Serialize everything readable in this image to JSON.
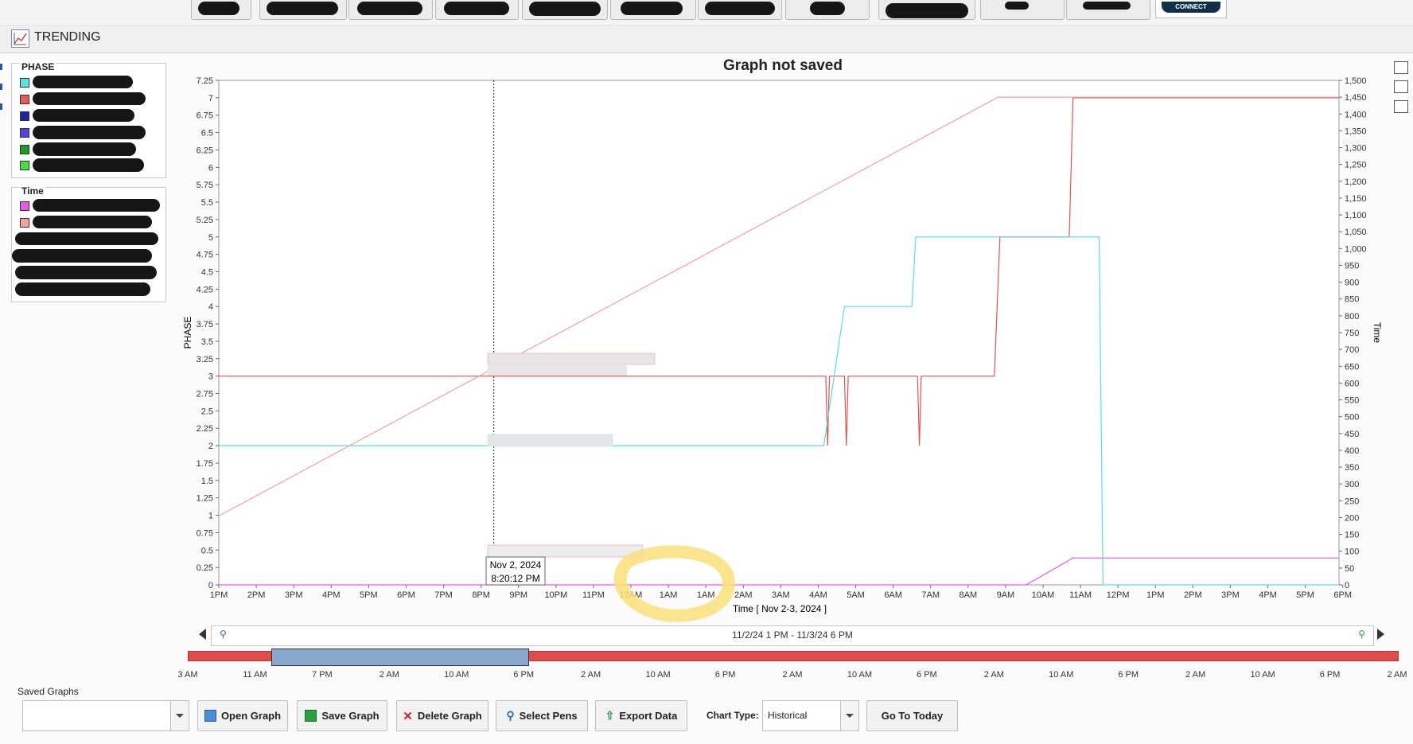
{
  "top_toolbar": {
    "connect_label": "CONNECT"
  },
  "header": {
    "title": "TRENDING"
  },
  "legends": [
    {
      "title": "PHASE",
      "swatches": [
        "#5ce1e6",
        "#e85a5a",
        "#1f1fb0",
        "#4a4ad8",
        "#1f9b1f",
        "#46e046"
      ]
    },
    {
      "title": "Time",
      "swatches": [
        "#ee55ee",
        "#f2a0a0"
      ]
    }
  ],
  "chart": {
    "title": "Graph not saved",
    "x_axis_label": "Time  [ Nov 2-3, 2024 ]",
    "y_left_label": "PHASE",
    "y_right_label": "Time",
    "cursor_tooltip": {
      "date": "Nov 2, 2024",
      "time": "8:20:12 PM"
    }
  },
  "chart_data": {
    "type": "line",
    "title": "Graph not saved",
    "xlabel": "Time  [ Nov 2-3, 2024 ]",
    "ylabel_left": "PHASE",
    "ylabel_right": "Time",
    "x_tick_labels": [
      "1PM",
      "2PM",
      "3PM",
      "4PM",
      "5PM",
      "6PM",
      "7PM",
      "8PM",
      "9PM",
      "10PM",
      "11PM",
      "12AM",
      "1AM",
      "1AM",
      "2AM",
      "3AM",
      "4AM",
      "5AM",
      "6AM",
      "7AM",
      "8AM",
      "9AM",
      "10AM",
      "11AM",
      "12PM",
      "1PM",
      "2PM",
      "3PM",
      "4PM",
      "5PM",
      "6PM"
    ],
    "x_range": [
      "11/2/24 1 PM",
      "11/3/24 6:55 PM"
    ],
    "y_left_range": [
      0,
      7.25
    ],
    "y_left_ticks": [
      "0",
      "0.25",
      "0.5",
      "0.75",
      "1",
      "1.25",
      "1.5",
      "1.75",
      "2",
      "2.25",
      "2.5",
      "2.75",
      "3",
      "3.25",
      "3.5",
      "3.75",
      "4",
      "4.25",
      "4.5",
      "4.75",
      "5",
      "5.25",
      "5.5",
      "5.75",
      "6",
      "6.25",
      "6.5",
      "6.75",
      "7",
      "7.25"
    ],
    "y_right_range": [
      0,
      1500
    ],
    "y_right_ticks": [
      "0",
      "50",
      "100",
      "150",
      "200",
      "250",
      "300",
      "350",
      "400",
      "450",
      "500",
      "550",
      "600",
      "650",
      "700",
      "750",
      "800",
      "850",
      "900",
      "950",
      "1,000",
      "1,050",
      "1,100",
      "1,150",
      "1,200",
      "1,250",
      "1,300",
      "1,350",
      "1,400",
      "1,450",
      "1,500"
    ],
    "grid": false,
    "cursor_hours": 7.34,
    "series": [
      {
        "axis": "left",
        "color": "#e85050",
        "points": [
          [
            0,
            3
          ],
          [
            16.2,
            3
          ],
          [
            16.25,
            2
          ],
          [
            16.3,
            3
          ],
          [
            16.7,
            3
          ],
          [
            16.75,
            2
          ],
          [
            16.8,
            3
          ],
          [
            18.65,
            3
          ],
          [
            18.7,
            2
          ],
          [
            18.75,
            3
          ],
          [
            20.7,
            3
          ],
          [
            20.85,
            5
          ],
          [
            22.7,
            5
          ],
          [
            22.8,
            7
          ],
          [
            29.9,
            7
          ]
        ]
      },
      {
        "axis": "left",
        "color": "#56dde8",
        "points": [
          [
            0,
            2
          ],
          [
            16.15,
            2
          ],
          [
            16.7,
            4
          ],
          [
            18.5,
            4
          ],
          [
            18.6,
            5
          ],
          [
            23.5,
            5
          ],
          [
            23.6,
            0
          ],
          [
            29.9,
            0
          ]
        ]
      },
      {
        "axis": "right",
        "color": "#f5a0a0",
        "points": [
          [
            0,
            205
          ],
          [
            20.8,
            1450
          ],
          [
            29.9,
            1450
          ]
        ]
      },
      {
        "axis": "right",
        "color": "#ee55ee",
        "points": [
          [
            0,
            0
          ],
          [
            21.55,
            0
          ],
          [
            22.8,
            80
          ],
          [
            29.9,
            80
          ]
        ]
      }
    ]
  },
  "range_nav": {
    "label": "11/2/24 1 PM - 11/3/24 6 PM"
  },
  "overview": {
    "labels": [
      "3 AM",
      "11 AM",
      "7 PM",
      "2 AM",
      "10 AM",
      "6 PM",
      "2 AM",
      "10 AM",
      "6 PM",
      "2 AM",
      "10 AM",
      "6 PM",
      "2 AM",
      "10 AM",
      "6 PM",
      "2 AM",
      "10 AM",
      "6 PM",
      "2 AM"
    ],
    "selection": [
      0.069,
      0.281
    ]
  },
  "footer": {
    "saved_graphs_label": "Saved Graphs",
    "saved_graphs_value": "",
    "open_label": "Open Graph",
    "save_label": "Save Graph",
    "delete_label": "Delete Graph",
    "select_pens_label": "Select Pens",
    "export_label": "Export Data",
    "chart_type_label": "Chart Type:",
    "chart_type_value": "Historical",
    "go_today_label": "Go To Today"
  },
  "colors": {
    "accent": "#10304a",
    "overview_bar": "#e04b4b",
    "overview_selection": "#89a8d0",
    "highlight": "#f9e07a"
  }
}
